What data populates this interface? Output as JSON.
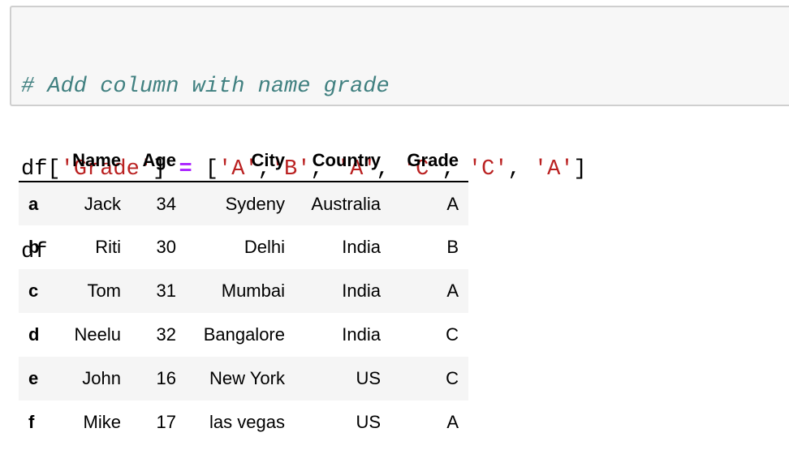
{
  "code_cell": {
    "line1_comment": "# Add column with name grade",
    "line2": {
      "df": "df",
      "open_bracket": "[",
      "col_name": "'Grade'",
      "close_bracket": "]",
      "equals": "=",
      "list_open": "[",
      "v1": "'A'",
      "c1": ",",
      "v2": "'B'",
      "c2": ",",
      "v3": "'A'",
      "c3": ",",
      "v4": "'C'",
      "c4": ",",
      "v5": "'C'",
      "c5": ",",
      "v6": "'A'",
      "list_close": "]"
    },
    "line3": "df"
  },
  "table": {
    "columns": [
      "",
      "Name",
      "Age",
      "City",
      "Country",
      "Grade"
    ],
    "rows": [
      {
        "index": "a",
        "cells": [
          "Jack",
          "34",
          "Sydeny",
          "Australia",
          "A"
        ]
      },
      {
        "index": "b",
        "cells": [
          "Riti",
          "30",
          "Delhi",
          "India",
          "B"
        ]
      },
      {
        "index": "c",
        "cells": [
          "Tom",
          "31",
          "Mumbai",
          "India",
          "A"
        ]
      },
      {
        "index": "d",
        "cells": [
          "Neelu",
          "32",
          "Bangalore",
          "India",
          "C"
        ]
      },
      {
        "index": "e",
        "cells": [
          "John",
          "16",
          "New York",
          "US",
          "C"
        ]
      },
      {
        "index": "f",
        "cells": [
          "Mike",
          "17",
          "las vegas",
          "US",
          "A"
        ]
      }
    ]
  },
  "colors": {
    "comment": "#408080",
    "string": "#ba2121",
    "operator": "#aa22ff",
    "cell_background": "#f7f7f7",
    "stripe": "#f5f5f5"
  }
}
